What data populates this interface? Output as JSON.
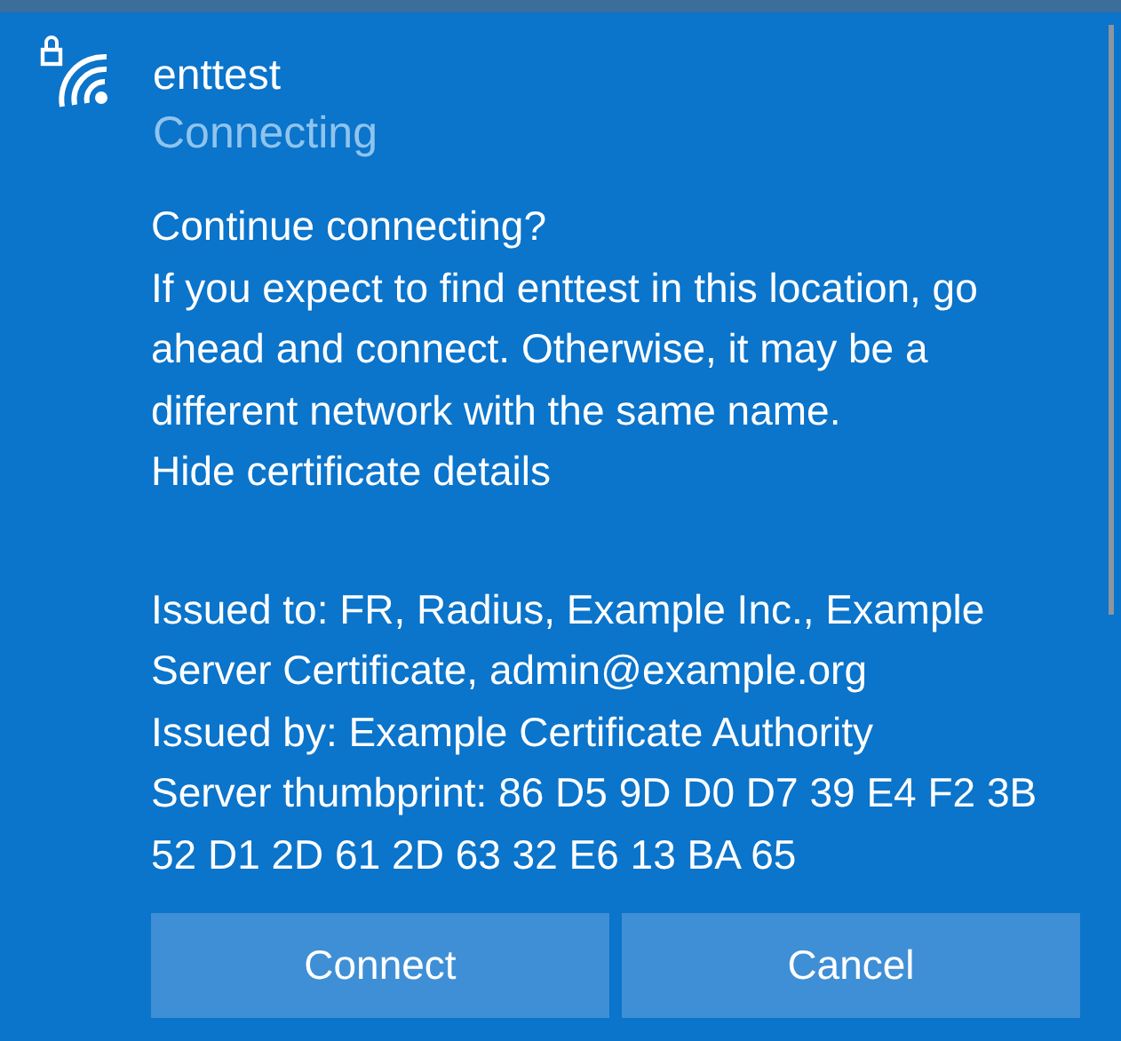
{
  "network": {
    "name": "enttest",
    "status": "Connecting",
    "secured": true
  },
  "prompt": {
    "heading": "Continue connecting?",
    "message": "If you expect to find enttest in this location, go ahead and connect. Otherwise, it may be a different network with the same name.",
    "link": "Hide certificate details"
  },
  "certificate": [
    "Issued to: FR, Radius, Example Inc., Example Server Certificate, admin@example.org",
    "Issued by: Example Certificate Authority",
    "Server thumbprint: 86 D5 9D D0 D7 39 E4 F2 3B 52 D1 2D 61 2D 63 32 E6 13 BA 65"
  ],
  "buttons": [
    "Connect",
    "Cancel"
  ]
}
